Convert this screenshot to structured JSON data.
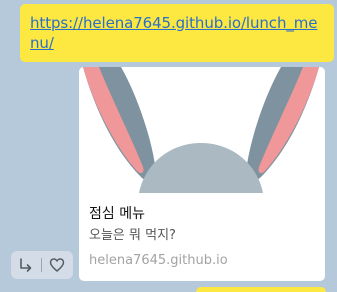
{
  "message": {
    "link_text": "https://helena7645.github.io/lunch_menu/",
    "link_color": "#2b6fc9",
    "bubble_color": "#fde842"
  },
  "preview": {
    "title": "점심 메뉴",
    "description": "오늘은 뭐 먹지?",
    "domain": "helena7645.github.io",
    "image": "rabbit-ears-illustration"
  },
  "actions": {
    "share_icon": "share-arrow-icon",
    "like_icon": "heart-icon"
  },
  "colors": {
    "chat_background": "#b6c9da",
    "ear_outer": "#7e929f",
    "ear_inner": "#ef9799",
    "head": "#aab9c2"
  }
}
